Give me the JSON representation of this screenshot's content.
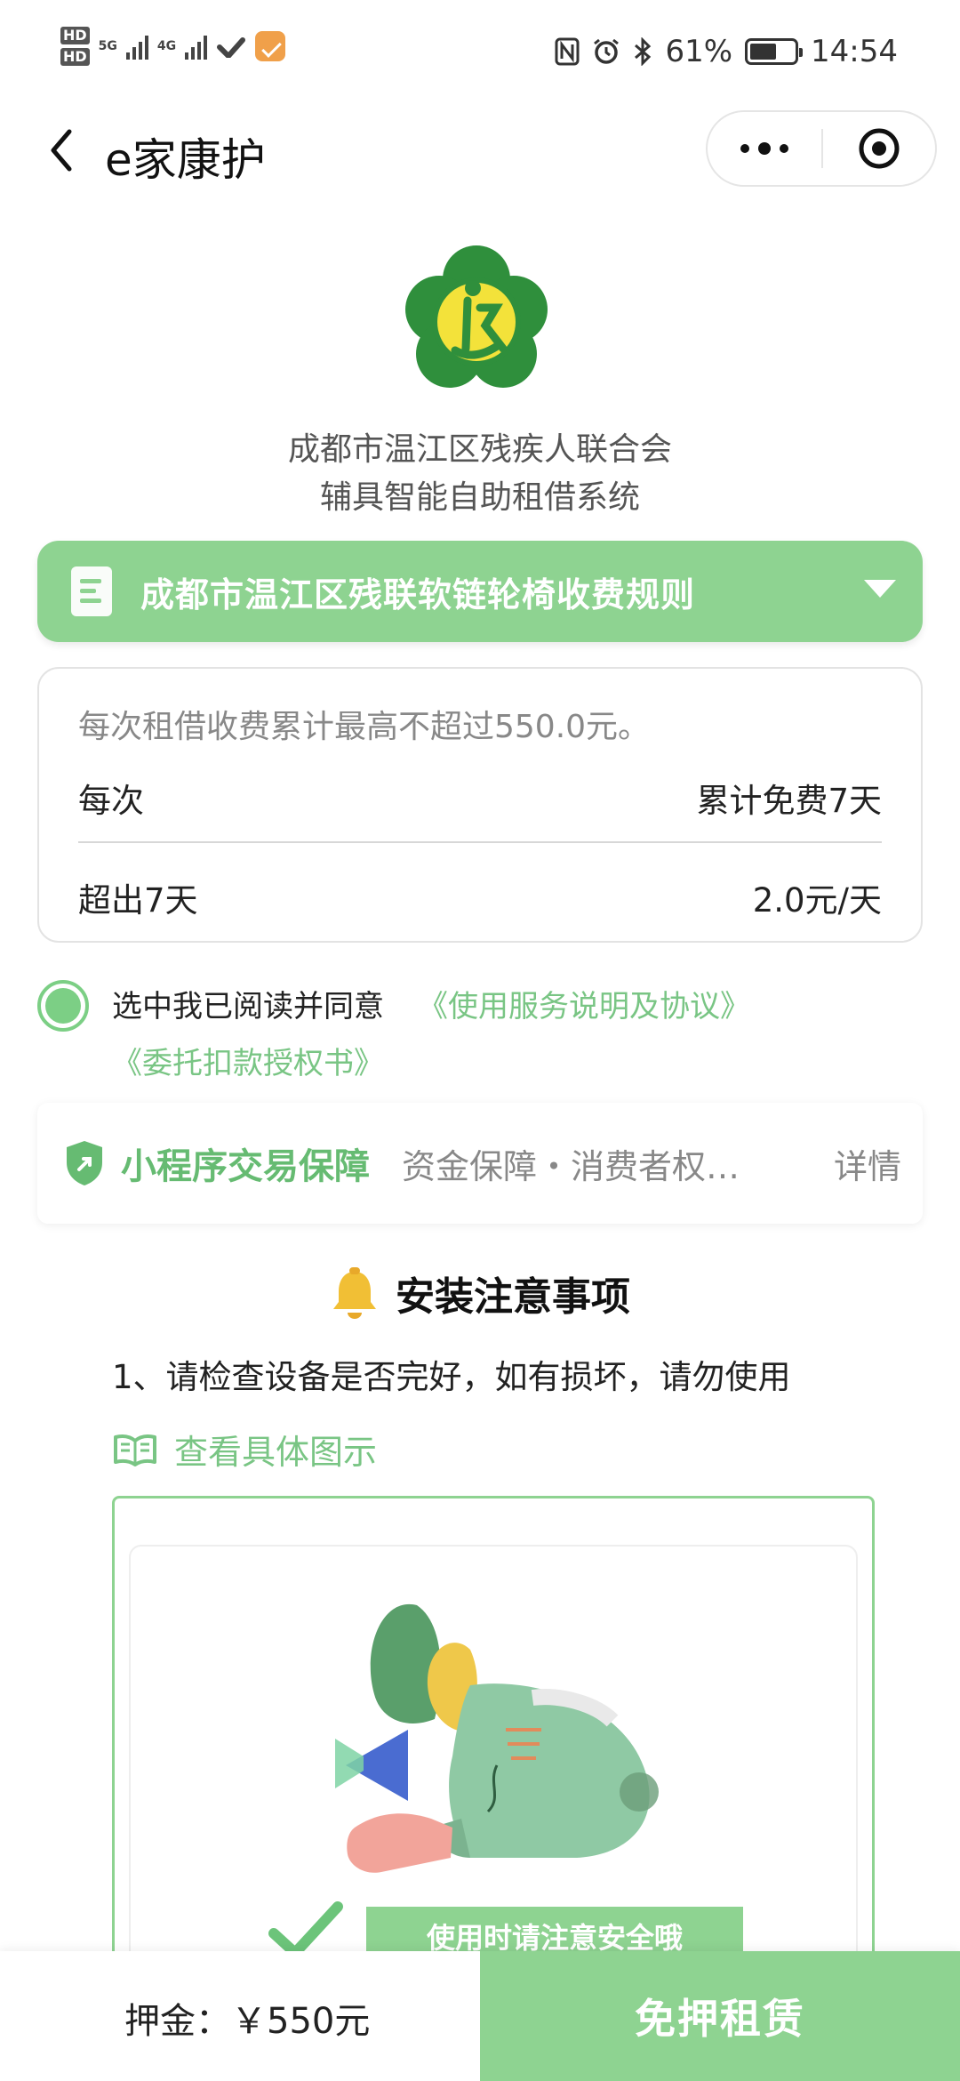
{
  "status_bar": {
    "hd1": "HD",
    "hd2": "HD",
    "net1": "5G",
    "net2": "4G",
    "battery": "61%",
    "time": "14:54",
    "battery_level": 0.61,
    "icons": [
      "nfc-icon",
      "alarm-icon",
      "bluetooth-icon"
    ]
  },
  "nav": {
    "title": "e家康护"
  },
  "header": {
    "org_line1": "成都市温江区残疾人联合会",
    "org_line2": "辅具智能自助租借系统"
  },
  "rule": {
    "title": "成都市温江区残联软链轮椅收费规则"
  },
  "fee": {
    "note": "每次租借收费累计最高不超过550.0元。",
    "rows": [
      {
        "label": "每次",
        "value": "累计免费7天"
      },
      {
        "label": "超出7天",
        "value": "2.0元/天"
      }
    ]
  },
  "agreement": {
    "text": "选中我已阅读并同意",
    "link1": "《使用服务说明及协议》",
    "link2": "《委托扣款授权书》",
    "checked": true
  },
  "guarantee": {
    "title": "小程序交易保障",
    "desc": "资金保障・消费者权…",
    "detail": "详情"
  },
  "notes": {
    "title": "安装注意事项",
    "item1": "1、请检查设备是否完好，如有损坏，请勿使用",
    "view_label": "查看具体图示",
    "safety_label": "使用时请注意安全哦"
  },
  "bottom": {
    "deposit": "押金：￥550元",
    "rent_button": "免押租赁"
  },
  "colors": {
    "brand_green": "#8ed391",
    "link_green": "#79c584"
  }
}
